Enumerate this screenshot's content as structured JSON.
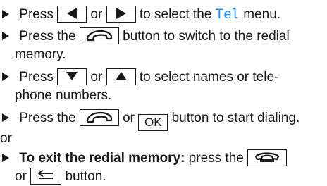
{
  "steps": [
    {
      "t1": "Press",
      "t2": "or",
      "t3": "to select the",
      "menu": "Tel",
      "t4": "menu."
    },
    {
      "t1": "Press the",
      "t2": "button to switch to the redial",
      "t3": "memory."
    },
    {
      "t1": "Press",
      "t2": "or",
      "t3": "to select names or tele-",
      "t4": "phone numbers."
    },
    {
      "t1": "Press the",
      "t2": "or",
      "t3": "button to start dialing."
    }
  ],
  "or_text": "or",
  "exit": {
    "bold": "To exit the redial memory:",
    "t1": "press the",
    "t2": "or",
    "t3": "button."
  },
  "keys": {
    "left": "left-arrow-icon",
    "right": "right-arrow-icon",
    "down": "down-arrow-icon",
    "up": "up-arrow-icon",
    "phone": "phone-handset-icon",
    "hangup": "hang-up-icon",
    "back": "back-icon",
    "ok_label": "OK"
  },
  "colors": {
    "highlight": "#1e90ff",
    "text": "#1a1a1a"
  }
}
